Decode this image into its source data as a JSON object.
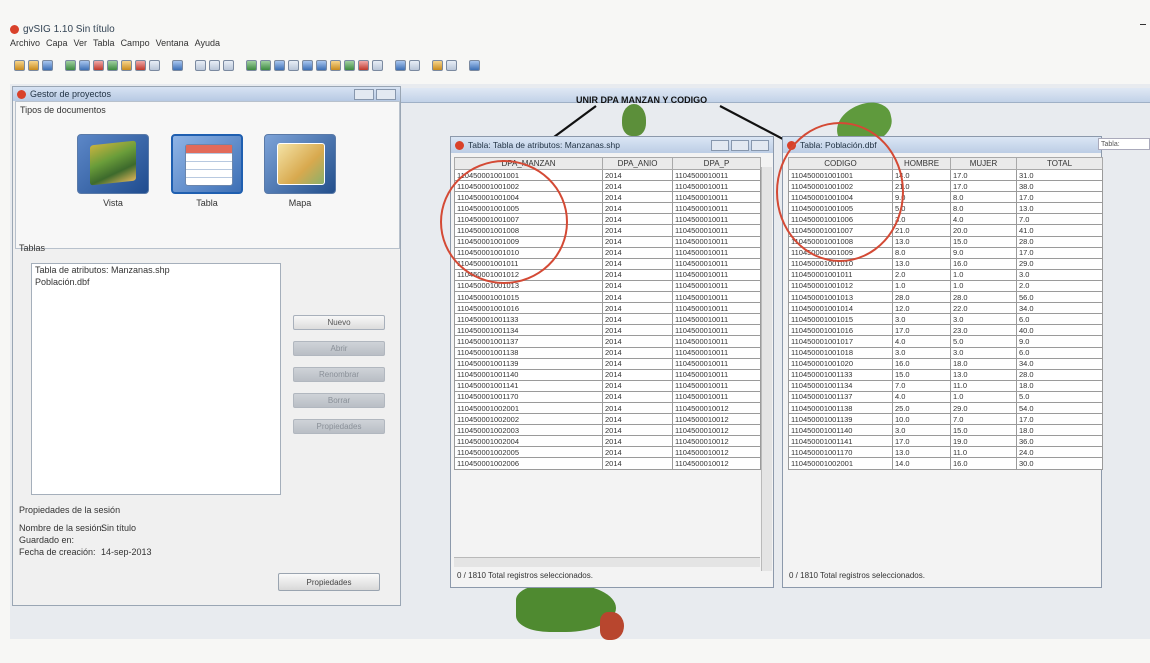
{
  "app": {
    "title": "gvSIG 1.10 Sin título"
  },
  "menu": [
    "Archivo",
    "Capa",
    "Ver",
    "Tabla",
    "Campo",
    "Ventana",
    "Ayuda"
  ],
  "project_manager": {
    "title": "Gestor de proyectos",
    "doc_types_label": "Tipos de documentos",
    "doc_types": [
      "Vista",
      "Tabla",
      "Mapa"
    ],
    "tables_label": "Tablas",
    "tables": [
      "Tabla de atributos: Manzanas.shp",
      "Población.dbf"
    ],
    "buttons": {
      "new": "Nuevo",
      "open": "Abrir",
      "rename": "Renombrar",
      "delete": "Borrar",
      "properties": "Propiedades"
    },
    "session": {
      "title": "Propiedades de la sesión",
      "name_label": "Nombre de la sesión:",
      "name_value": "Sin título",
      "saved_label": "Guardado en:",
      "saved_value": "",
      "date_label": "Fecha de creación:",
      "date_value": "14-sep-2013"
    },
    "props_button": "Propiedades"
  },
  "annotation": "UNIR DPA MANZAN Y CODIGO",
  "right_edge_text": "Tabla: Población.dbf",
  "table1": {
    "title": "Tabla: Tabla de atributos: Manzanas.shp",
    "columns": [
      "DPA_MANZAN",
      "DPA_ANIO",
      "DPA_P"
    ],
    "rows": [
      [
        "110450001001001",
        "2014",
        "1104500010011"
      ],
      [
        "110450001001002",
        "2014",
        "1104500010011"
      ],
      [
        "110450001001004",
        "2014",
        "1104500010011"
      ],
      [
        "110450001001005",
        "2014",
        "1104500010011"
      ],
      [
        "110450001001007",
        "2014",
        "1104500010011"
      ],
      [
        "110450001001008",
        "2014",
        "1104500010011"
      ],
      [
        "110450001001009",
        "2014",
        "1104500010011"
      ],
      [
        "110450001001010",
        "2014",
        "1104500010011"
      ],
      [
        "110450001001011",
        "2014",
        "1104500010011"
      ],
      [
        "110450001001012",
        "2014",
        "1104500010011"
      ],
      [
        "110450001001013",
        "2014",
        "1104500010011"
      ],
      [
        "110450001001015",
        "2014",
        "1104500010011"
      ],
      [
        "110450001001016",
        "2014",
        "1104500010011"
      ],
      [
        "110450001001133",
        "2014",
        "1104500010011"
      ],
      [
        "110450001001134",
        "2014",
        "1104500010011"
      ],
      [
        "110450001001137",
        "2014",
        "1104500010011"
      ],
      [
        "110450001001138",
        "2014",
        "1104500010011"
      ],
      [
        "110450001001139",
        "2014",
        "1104500010011"
      ],
      [
        "110450001001140",
        "2014",
        "1104500010011"
      ],
      [
        "110450001001141",
        "2014",
        "1104500010011"
      ],
      [
        "110450001001170",
        "2014",
        "1104500010011"
      ],
      [
        "110450001002001",
        "2014",
        "1104500010012"
      ],
      [
        "110450001002002",
        "2014",
        "1104500010012"
      ],
      [
        "110450001002003",
        "2014",
        "1104500010012"
      ],
      [
        "110450001002004",
        "2014",
        "1104500010012"
      ],
      [
        "110450001002005",
        "2014",
        "1104500010012"
      ],
      [
        "110450001002006",
        "2014",
        "1104500010012"
      ]
    ],
    "status": "0 / 1810 Total registros seleccionados."
  },
  "table2": {
    "title": "Tabla: Población.dbf",
    "columns": [
      "CODIGO",
      "HOMBRE",
      "MUJER",
      "TOTAL"
    ],
    "rows": [
      [
        "110450001001001",
        "14.0",
        "17.0",
        "31.0"
      ],
      [
        "110450001001002",
        "21.0",
        "17.0",
        "38.0"
      ],
      [
        "110450001001004",
        "9.0",
        "8.0",
        "17.0"
      ],
      [
        "110450001001005",
        "5.0",
        "8.0",
        "13.0"
      ],
      [
        "110450001001006",
        "3.0",
        "4.0",
        "7.0"
      ],
      [
        "110450001001007",
        "21.0",
        "20.0",
        "41.0"
      ],
      [
        "110450001001008",
        "13.0",
        "15.0",
        "28.0"
      ],
      [
        "110450001001009",
        "8.0",
        "9.0",
        "17.0"
      ],
      [
        "110450001001010",
        "13.0",
        "16.0",
        "29.0"
      ],
      [
        "110450001001011",
        "2.0",
        "1.0",
        "3.0"
      ],
      [
        "110450001001012",
        "1.0",
        "1.0",
        "2.0"
      ],
      [
        "110450001001013",
        "28.0",
        "28.0",
        "56.0"
      ],
      [
        "110450001001014",
        "12.0",
        "22.0",
        "34.0"
      ],
      [
        "110450001001015",
        "3.0",
        "3.0",
        "6.0"
      ],
      [
        "110450001001016",
        "17.0",
        "23.0",
        "40.0"
      ],
      [
        "110450001001017",
        "4.0",
        "5.0",
        "9.0"
      ],
      [
        "110450001001018",
        "3.0",
        "3.0",
        "6.0"
      ],
      [
        "110450001001020",
        "16.0",
        "18.0",
        "34.0"
      ],
      [
        "110450001001133",
        "15.0",
        "13.0",
        "28.0"
      ],
      [
        "110450001001134",
        "7.0",
        "11.0",
        "18.0"
      ],
      [
        "110450001001137",
        "4.0",
        "1.0",
        "5.0"
      ],
      [
        "110450001001138",
        "25.0",
        "29.0",
        "54.0"
      ],
      [
        "110450001001139",
        "10.0",
        "7.0",
        "17.0"
      ],
      [
        "110450001001140",
        "3.0",
        "15.0",
        "18.0"
      ],
      [
        "110450001001141",
        "17.0",
        "19.0",
        "36.0"
      ],
      [
        "110450001001170",
        "13.0",
        "11.0",
        "24.0"
      ],
      [
        "110450001002001",
        "14.0",
        "16.0",
        "30.0"
      ]
    ],
    "status": "0 / 1810 Total registros seleccionados."
  }
}
